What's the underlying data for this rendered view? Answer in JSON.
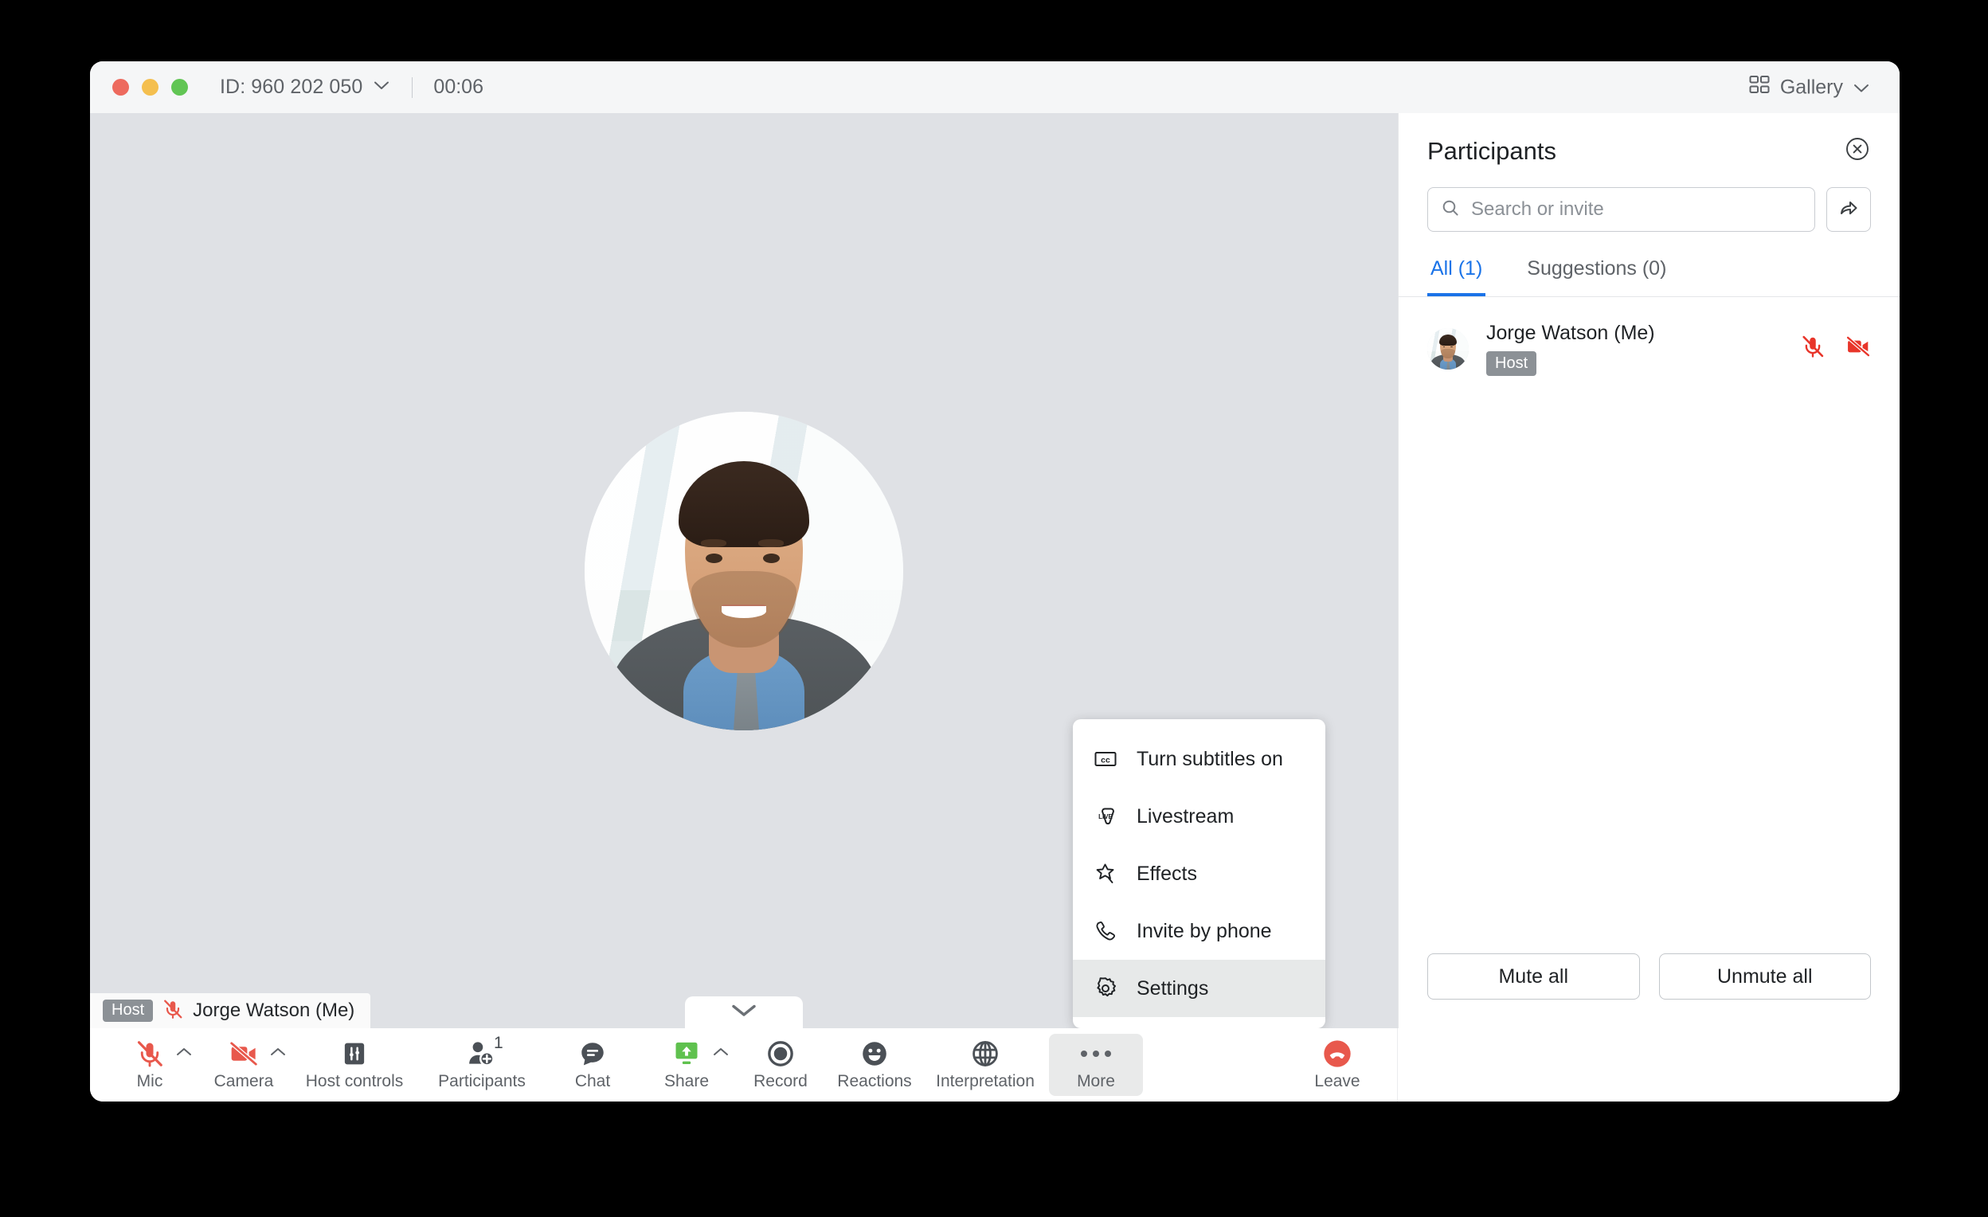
{
  "titlebar": {
    "meeting_id": "ID: 960 202 050",
    "timer": "00:06",
    "gallery_label": "Gallery",
    "traffic": {
      "close": "close-window",
      "minimize": "minimize-window",
      "zoom": "zoom-window"
    }
  },
  "stage": {
    "name_badge": {
      "host_label": "Host",
      "name": "Jorge Watson (Me)"
    }
  },
  "more_menu": {
    "items": [
      {
        "label": "Turn subtitles on",
        "icon": "closed-caption-icon",
        "active": false
      },
      {
        "label": "Livestream",
        "icon": "livestream-icon",
        "active": false
      },
      {
        "label": "Effects",
        "icon": "effects-sparkle-icon",
        "active": false
      },
      {
        "label": "Invite by phone",
        "icon": "phone-icon",
        "active": false
      },
      {
        "label": "Settings",
        "icon": "gear-icon",
        "active": true
      }
    ]
  },
  "panel": {
    "title": "Participants",
    "close_icon": "close-circle-icon",
    "search": {
      "placeholder": "Search or invite",
      "value": "",
      "icon": "search-icon"
    },
    "invite_icon": "share-arrow-icon",
    "tabs": [
      {
        "label": "All (1)",
        "selected": true
      },
      {
        "label": "Suggestions (0)",
        "selected": false
      }
    ],
    "participants": [
      {
        "name": "Jorge Watson (Me)",
        "role_badge": "Host",
        "mic_icon": "mic-off-icon",
        "camera_icon": "camera-off-icon",
        "mic_muted": true,
        "camera_off": true
      }
    ],
    "footer": {
      "mute_all": "Mute all",
      "unmute_all": "Unmute all"
    }
  },
  "toolbar": {
    "items": [
      {
        "label": "Mic",
        "icon": "mic-off-icon",
        "caret": true,
        "count": null,
        "highlight": false
      },
      {
        "label": "Camera",
        "icon": "camera-off-icon",
        "caret": true,
        "count": null,
        "highlight": false
      },
      {
        "label": "Host controls",
        "icon": "sliders-icon",
        "caret": false,
        "count": null,
        "highlight": false
      },
      {
        "label": "Participants",
        "icon": "add-person-icon",
        "caret": false,
        "count": "1",
        "highlight": false
      },
      {
        "label": "Chat",
        "icon": "chat-bubble-icon",
        "caret": false,
        "count": null,
        "highlight": false
      },
      {
        "label": "Share",
        "icon": "share-screen-icon",
        "caret": true,
        "count": null,
        "highlight": false
      },
      {
        "label": "Record",
        "icon": "record-icon",
        "caret": false,
        "count": null,
        "highlight": false
      },
      {
        "label": "Reactions",
        "icon": "smiley-icon",
        "caret": false,
        "count": null,
        "highlight": false
      },
      {
        "label": "Interpretation",
        "icon": "globe-icon",
        "caret": false,
        "count": null,
        "highlight": false
      },
      {
        "label": "More",
        "icon": "ellipsis-icon",
        "caret": false,
        "count": null,
        "highlight": true
      },
      {
        "label": "Leave",
        "icon": "end-call-icon",
        "caret": false,
        "count": null,
        "highlight": false
      }
    ],
    "collapse_icon": "chevron-down-icon"
  },
  "colors": {
    "accent_blue": "#1a73e8",
    "danger_red": "#e8584c",
    "share_green": "#5fc14e",
    "stage_bg": "#dfe1e5",
    "chrome_gray": "#5f6368"
  }
}
